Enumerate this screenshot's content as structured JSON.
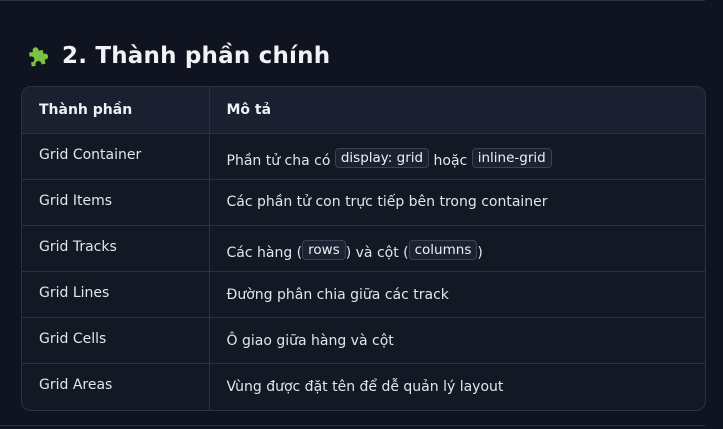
{
  "section": {
    "title": "2. Thành phần chính",
    "icon": "puzzle-icon",
    "icon_color": "#7cc244"
  },
  "table": {
    "headers": [
      "Thành phần",
      "Mô tả"
    ],
    "rows": [
      {
        "name": "Grid Container",
        "desc": [
          {
            "t": "Phần tử cha có "
          },
          {
            "code": "display: grid"
          },
          {
            "t": " hoặc "
          },
          {
            "code": "inline-grid"
          }
        ]
      },
      {
        "name": "Grid Items",
        "desc": [
          {
            "t": "Các phần tử con trực tiếp bên trong container"
          }
        ]
      },
      {
        "name": "Grid Tracks",
        "desc": [
          {
            "t": "Các hàng ("
          },
          {
            "code": "rows"
          },
          {
            "t": ") và cột ("
          },
          {
            "code": "columns"
          },
          {
            "t": ")"
          }
        ]
      },
      {
        "name": "Grid Lines",
        "desc": [
          {
            "t": "Đường phân chia giữa các track"
          }
        ]
      },
      {
        "name": "Grid Cells",
        "desc": [
          {
            "t": "Ô giao giữa hàng và cột"
          }
        ]
      },
      {
        "name": "Grid Areas",
        "desc": [
          {
            "t": "Vùng được đặt tên để dễ quản lý layout"
          }
        ]
      }
    ]
  }
}
